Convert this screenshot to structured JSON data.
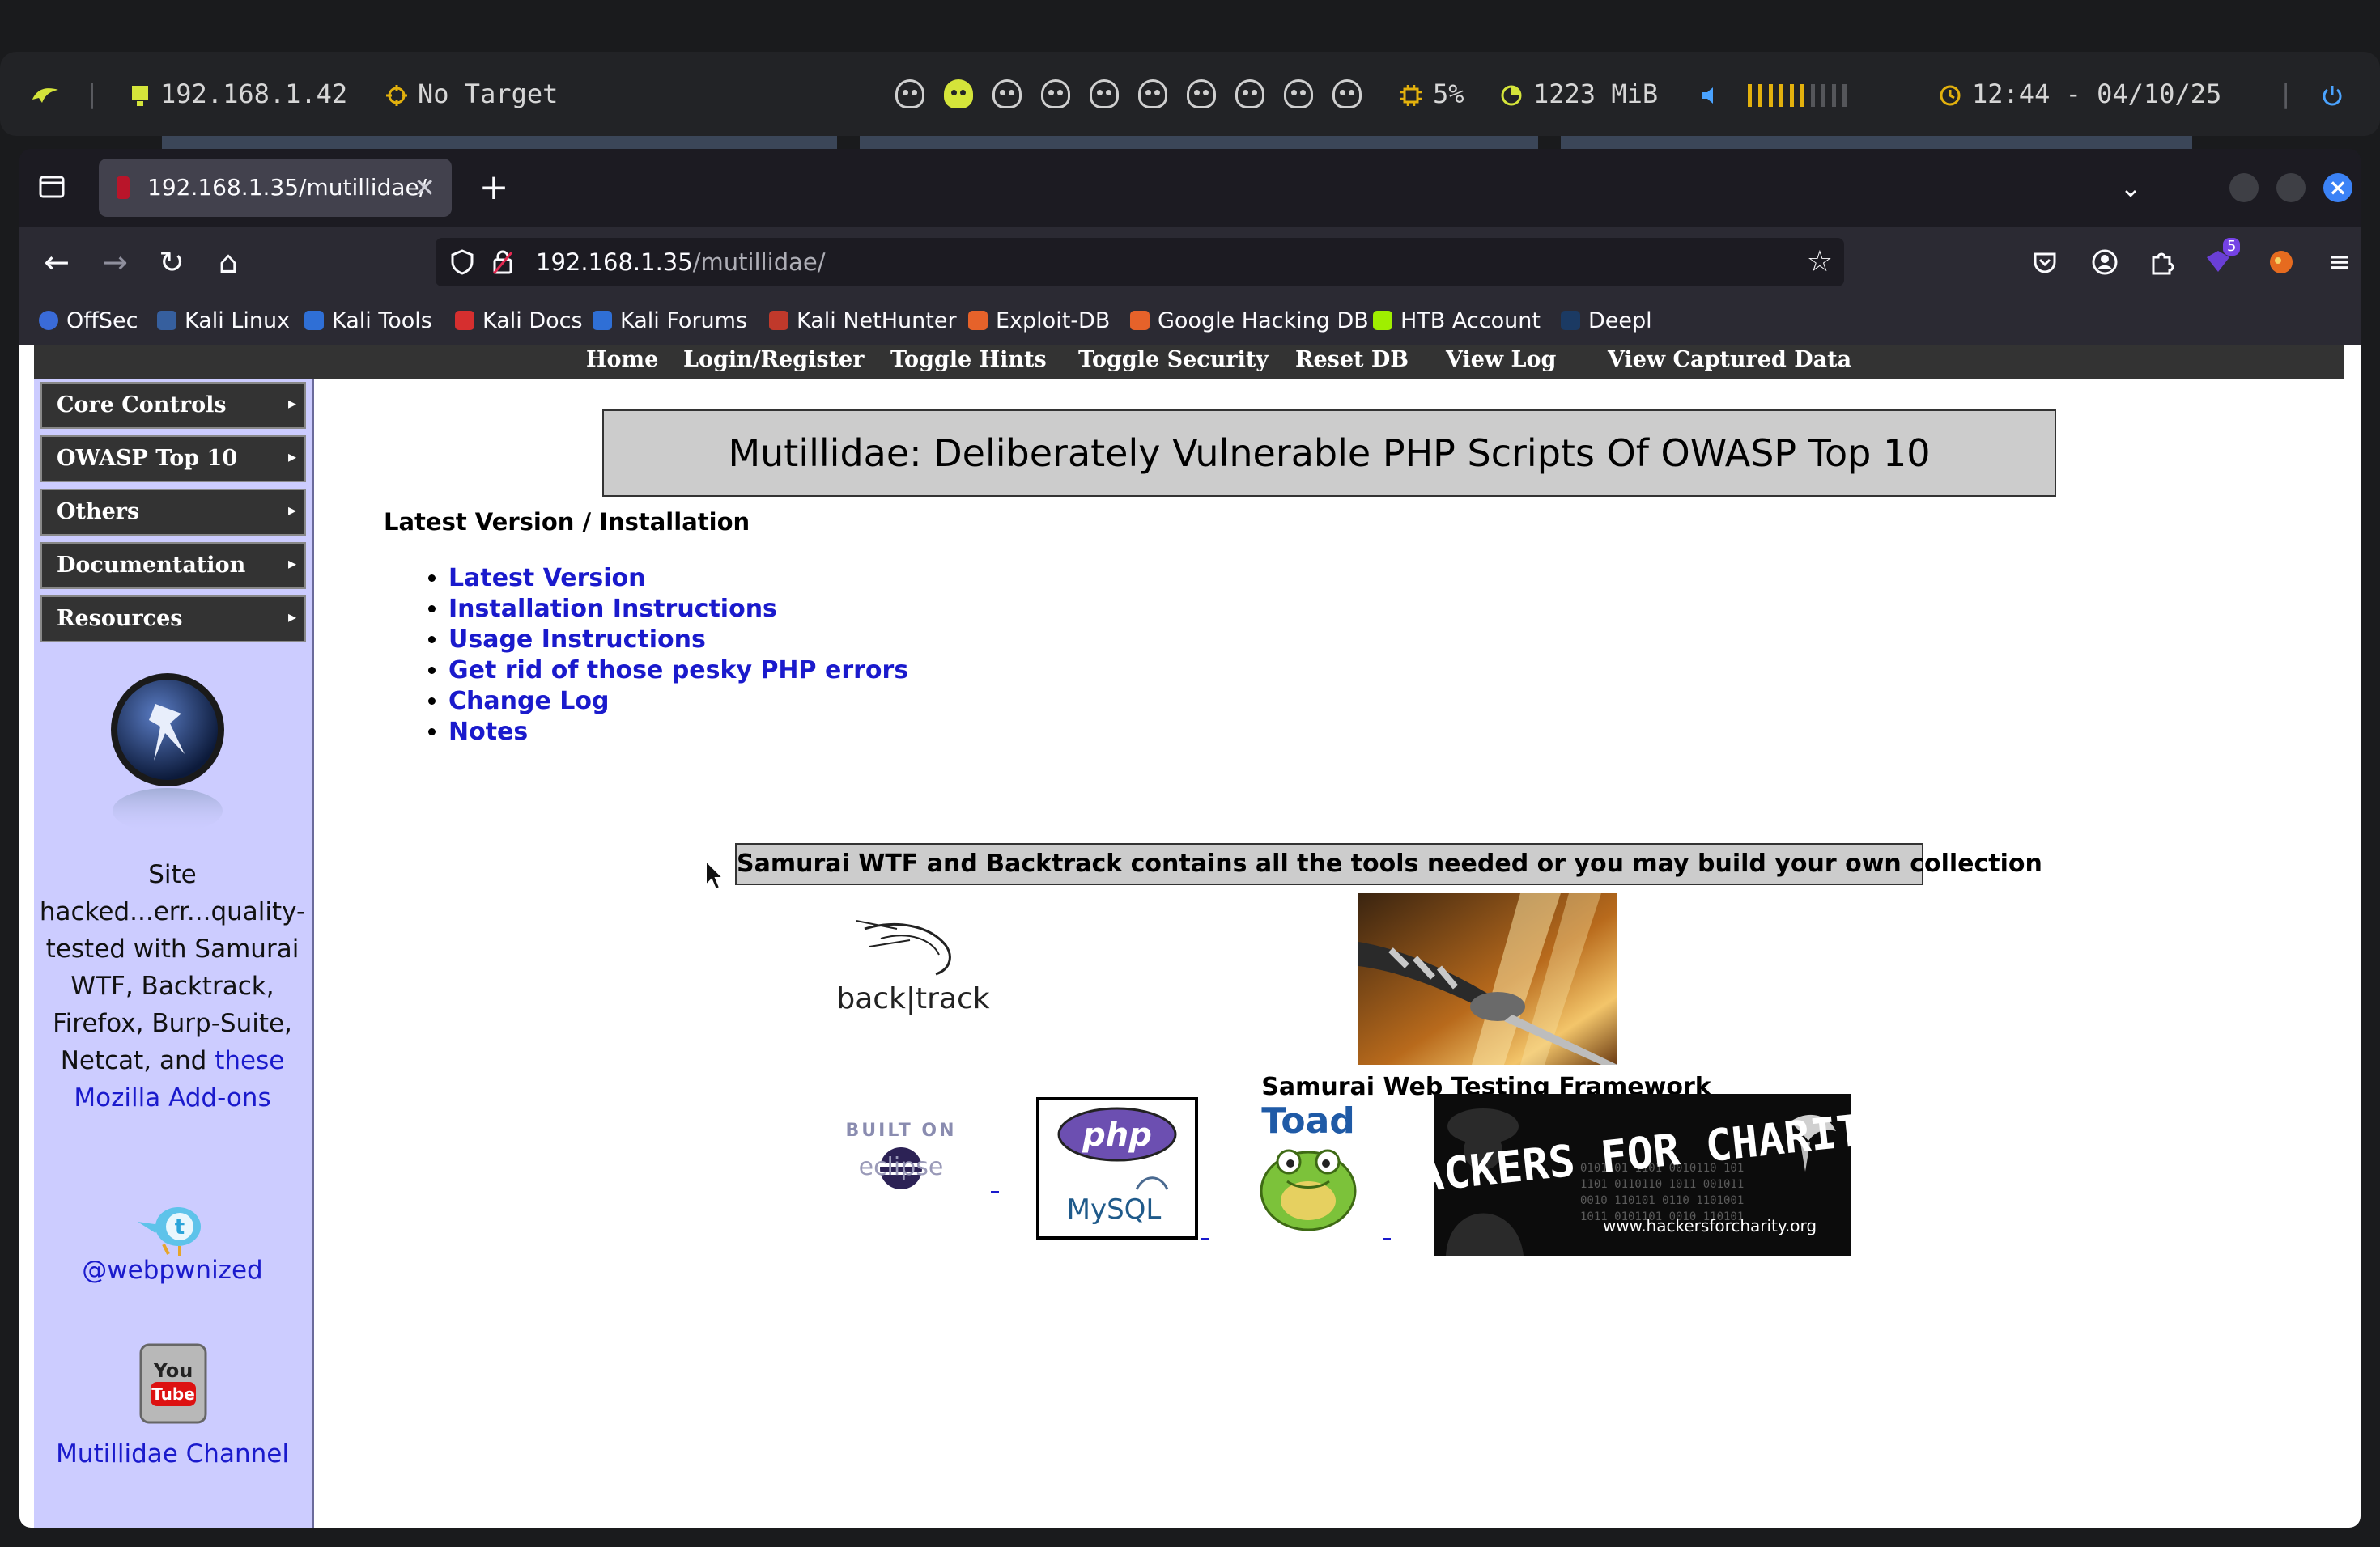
{
  "system_bar": {
    "ip": "192.168.1.42",
    "target": "No Target",
    "cpu": "5%",
    "memory": "1223 MiB",
    "clock": "12:44 - 04/10/25",
    "volume_level": 0.6,
    "workspaces": 10,
    "active_workspace": 2
  },
  "browser": {
    "tab_title": "192.168.1.35/mutillidae/",
    "url_host": "192.168.1.35",
    "url_path": "/mutillidae/",
    "extension_badge": "5",
    "bookmarks": [
      "OffSec",
      "Kali Linux",
      "Kali Tools",
      "Kali Docs",
      "Kali Forums",
      "Kali NetHunter",
      "Exploit-DB",
      "Google Hacking DB",
      "HTB Account",
      "Deepl"
    ]
  },
  "page": {
    "nav_links": [
      "Home",
      "Login/Register",
      "Toggle Hints",
      "Toggle Security",
      "Reset DB",
      "View Log",
      "View Captured Data"
    ],
    "menu": [
      "Core Controls",
      "OWASP Top 10",
      "Others",
      "Documentation",
      "Resources"
    ],
    "sidebar_blurb": "Site hacked...err...quality-tested with Samurai WTF, Backtrack, Firefox, Burp-Suite, Netcat, and",
    "sidebar_blurb_link": "these Mozilla Add-ons",
    "twitter_handle": "@webpwnized",
    "youtube_link": "Mutillidae Channel",
    "title": "Mutillidae: Deliberately Vulnerable PHP Scripts Of OWASP Top 10",
    "latest_heading": "Latest Version / Installation",
    "links": [
      "Latest Version",
      "Installation Instructions",
      "Usage Instructions",
      "Get rid of those pesky PHP errors",
      "Change Log",
      "Notes"
    ],
    "tools_banner": "Samurai WTF and Backtrack contains all the tools needed or you may build your own collection",
    "samurai_caption": "Samurai Web Testing Framework",
    "logos": {
      "backtrack": "back|track",
      "eclipse_built_on": "BUILT ON",
      "eclipse": "eclipse",
      "php": "php",
      "mysql": "MySQL",
      "toad": "Toad",
      "hfc_title": "HACKERS FOR CHARITY",
      "hfc_url": "www.hackersforcharity.org"
    }
  }
}
